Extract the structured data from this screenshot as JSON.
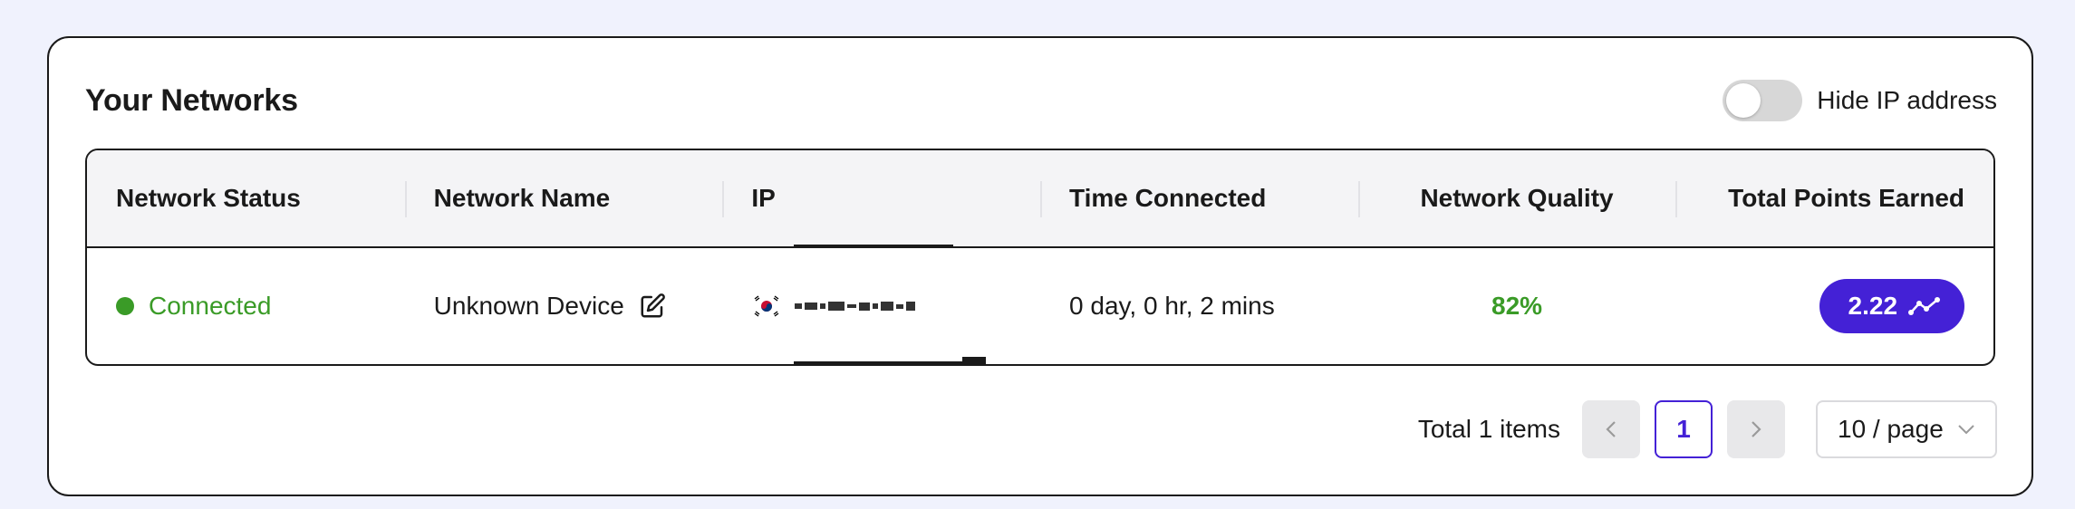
{
  "card": {
    "title": "Your Networks",
    "toggle_label": "Hide IP address",
    "toggle_on": false
  },
  "table": {
    "headers": [
      "Network Status",
      "Network Name",
      "IP",
      "Time Connected",
      "Network Quality",
      "Total Points Earned"
    ],
    "rows": [
      {
        "status": "Connected",
        "name": "Unknown Device",
        "ip_flag": "south-korea-flag-icon",
        "time_connected": "0 day, 0 hr, 2 mins",
        "quality": "82%",
        "points": "2.22"
      }
    ]
  },
  "pagination": {
    "total_label": "Total 1 items",
    "prev_icon": "chevron-left-icon",
    "current_page": "1",
    "next_icon": "chevron-right-icon",
    "page_size": "10 / page"
  },
  "colors": {
    "accent": "#4421d6",
    "status_green": "#3a9b27",
    "background": "#f0f2fd"
  }
}
